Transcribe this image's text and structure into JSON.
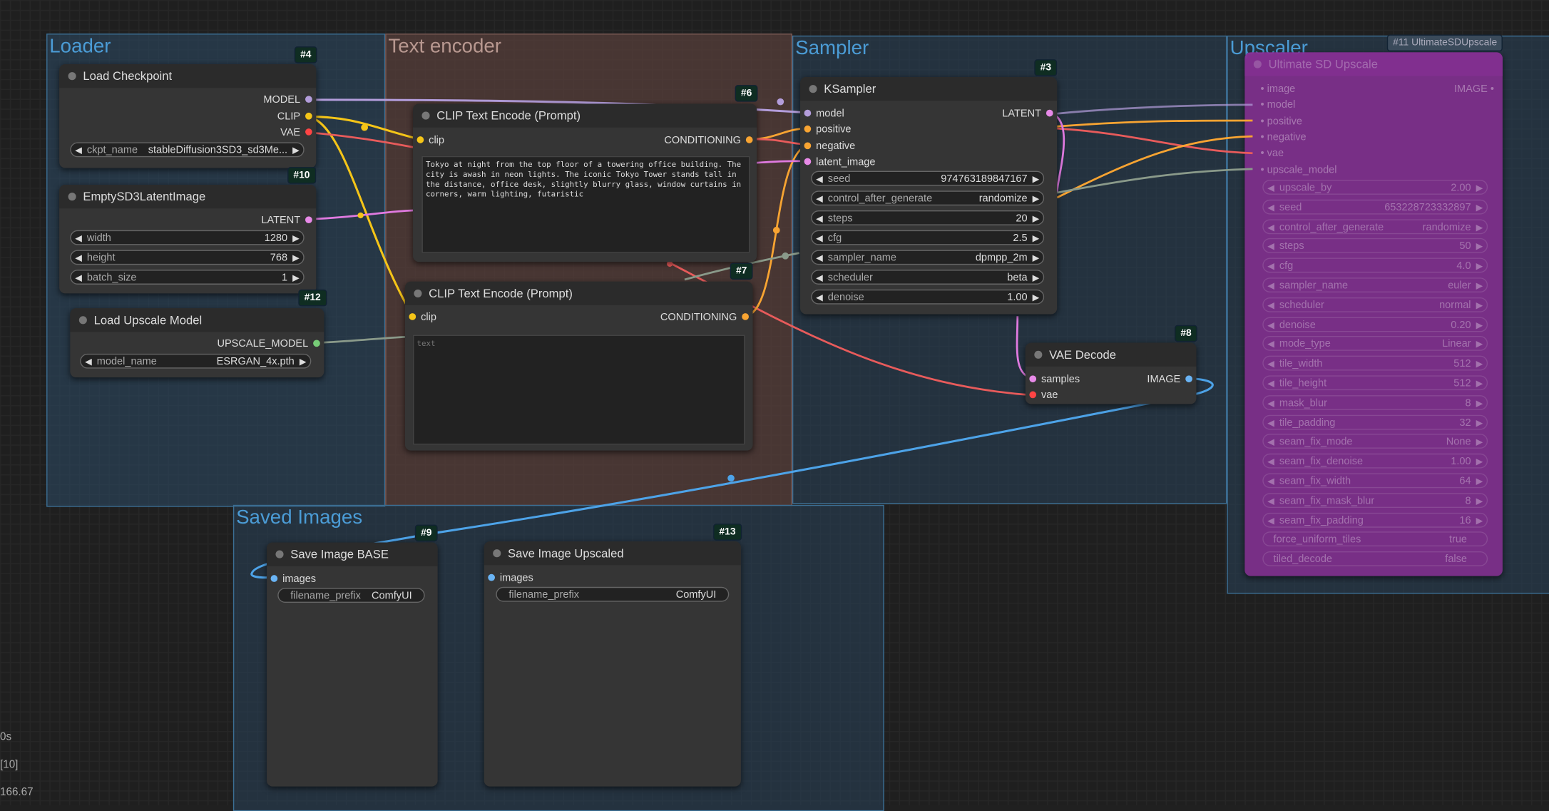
{
  "groups": {
    "loader": "Loader",
    "text_encoder": "Text encoder",
    "sampler": "Sampler",
    "upscaler": "Upscaler",
    "saved_images": "Saved Images"
  },
  "colors": {
    "loader_group": "#2b4a66",
    "text_group": "#5a403c",
    "sampler_group": "#2b4a66",
    "upscaler_node": "#7d2f8a",
    "wire_yellow": "#f5c518",
    "wire_blue": "#4da3e8",
    "wire_red": "#e85b5b",
    "wire_pink": "#e07ae0",
    "wire_purple": "#b39ddb",
    "wire_orange": "#f8a432",
    "wire_gray": "#8a9a8a"
  },
  "nodes": {
    "load_checkpoint": {
      "badge": "#4",
      "title": "Load Checkpoint",
      "outputs": [
        "MODEL",
        "CLIP",
        "VAE"
      ],
      "ckpt_name_label": "ckpt_name",
      "ckpt_name_value": "stableDiffusion3SD3_sd3Me..."
    },
    "empty_latent": {
      "badge": "#10",
      "title": "EmptySD3LatentImage",
      "output": "LATENT",
      "widgets": [
        {
          "name": "width",
          "value": "1280"
        },
        {
          "name": "height",
          "value": "768"
        },
        {
          "name": "batch_size",
          "value": "1"
        }
      ]
    },
    "load_upscale": {
      "badge": "#12",
      "title": "Load Upscale Model",
      "output": "UPSCALE_MODEL",
      "widget_name": "model_name",
      "widget_value": "ESRGAN_4x.pth"
    },
    "clip_pos": {
      "badge": "#6",
      "title": "CLIP Text Encode (Prompt)",
      "input": "clip",
      "output": "CONDITIONING",
      "text": "Tokyo at night from the top floor of a towering office building. The city is awash in neon lights. The iconic Tokyo Tower stands tall in the distance, office desk, slightly blurry glass, window curtains in corners, warm lighting, futaristic"
    },
    "clip_neg": {
      "badge": "#7",
      "title": "CLIP Text Encode (Prompt)",
      "input": "clip",
      "output": "CONDITIONING",
      "placeholder": "text"
    },
    "ksampler": {
      "badge": "#3",
      "title": "KSampler",
      "inputs": [
        "model",
        "positive",
        "negative",
        "latent_image"
      ],
      "output": "LATENT",
      "widgets": [
        {
          "name": "seed",
          "value": "974763189847167"
        },
        {
          "name": "control_after_generate",
          "value": "randomize"
        },
        {
          "name": "steps",
          "value": "20"
        },
        {
          "name": "cfg",
          "value": "2.5"
        },
        {
          "name": "sampler_name",
          "value": "dpmpp_2m"
        },
        {
          "name": "scheduler",
          "value": "beta"
        },
        {
          "name": "denoise",
          "value": "1.00"
        }
      ]
    },
    "vae_decode": {
      "badge": "#8",
      "title": "VAE Decode",
      "inputs": [
        "samples",
        "vae"
      ],
      "output": "IMAGE"
    },
    "save_base": {
      "badge": "#9",
      "title": "Save Image BASE",
      "input": "images",
      "widget_name": "filename_prefix",
      "widget_value": "ComfyUI"
    },
    "save_upscaled": {
      "badge": "#13",
      "title": "Save Image Upscaled",
      "input": "images",
      "widget_name": "filename_prefix",
      "widget_value": "ComfyUI"
    },
    "ultimate_sd": {
      "badge": "#11 UltimateSDUpscale",
      "title": "Ultimate SD Upscale",
      "inputs": [
        "image",
        "model",
        "positive",
        "negative",
        "vae",
        "upscale_model"
      ],
      "output": "IMAGE",
      "widgets": [
        {
          "name": "upscale_by",
          "value": "2.00"
        },
        {
          "name": "seed",
          "value": "653228723332897"
        },
        {
          "name": "control_after_generate",
          "value": "randomize"
        },
        {
          "name": "steps",
          "value": "50"
        },
        {
          "name": "cfg",
          "value": "4.0"
        },
        {
          "name": "sampler_name",
          "value": "euler"
        },
        {
          "name": "scheduler",
          "value": "normal"
        },
        {
          "name": "denoise",
          "value": "0.20"
        },
        {
          "name": "mode_type",
          "value": "Linear"
        },
        {
          "name": "tile_width",
          "value": "512"
        },
        {
          "name": "tile_height",
          "value": "512"
        },
        {
          "name": "mask_blur",
          "value": "8"
        },
        {
          "name": "tile_padding",
          "value": "32"
        },
        {
          "name": "seam_fix_mode",
          "value": "None"
        },
        {
          "name": "seam_fix_denoise",
          "value": "1.00"
        },
        {
          "name": "seam_fix_width",
          "value": "64"
        },
        {
          "name": "seam_fix_mask_blur",
          "value": "8"
        },
        {
          "name": "seam_fix_padding",
          "value": "16"
        },
        {
          "name": "force_uniform_tiles",
          "value": "true"
        },
        {
          "name": "tiled_decode",
          "value": "false"
        }
      ]
    }
  },
  "stats": {
    "line1": "0s",
    "line2": "[10]",
    "line3": "166.67"
  }
}
